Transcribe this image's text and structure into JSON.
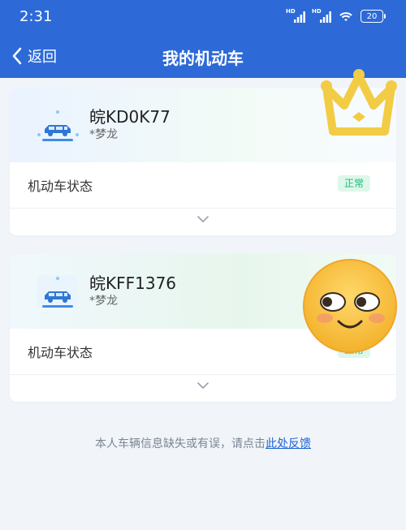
{
  "status_bar": {
    "time": "2:31",
    "signal1_label": "HD",
    "signal2_label": "HD",
    "battery": "20"
  },
  "nav": {
    "back_label": "返回",
    "title": "我的机动车"
  },
  "vehicles": [
    {
      "plate": "皖KD0K77",
      "owner": "*梦龙",
      "status_label": "机动车状态",
      "status": "正常"
    },
    {
      "plate": "皖KFF1376",
      "owner": "*梦龙",
      "status_label": "机动车状态",
      "status": "正常"
    }
  ],
  "footer": {
    "note": "本人车辆信息缺失或有误，请点击",
    "link": "此处反馈"
  },
  "colors": {
    "header_bg": "#2d6ad8",
    "status_green": "#1cbb7a",
    "link_blue": "#1e64d6"
  },
  "icons": [
    "back-arrow-icon",
    "car-icon",
    "chevron-down-icon",
    "wifi-icon",
    "battery-icon"
  ]
}
